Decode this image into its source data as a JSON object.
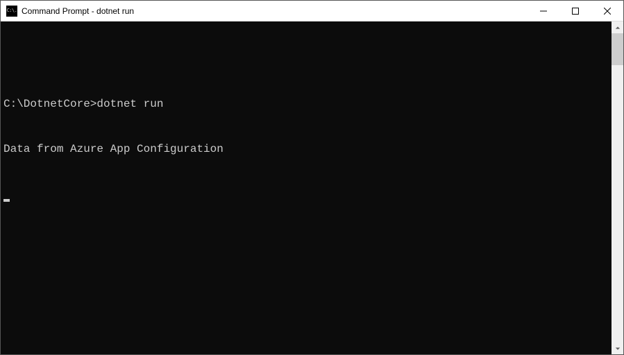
{
  "window": {
    "title": "Command Prompt - dotnet  run",
    "icon_text": "C:\\."
  },
  "terminal": {
    "prompt": "C:\\DotnetCore>",
    "command": "dotnet run",
    "output": "Data from Azure App Configuration"
  }
}
